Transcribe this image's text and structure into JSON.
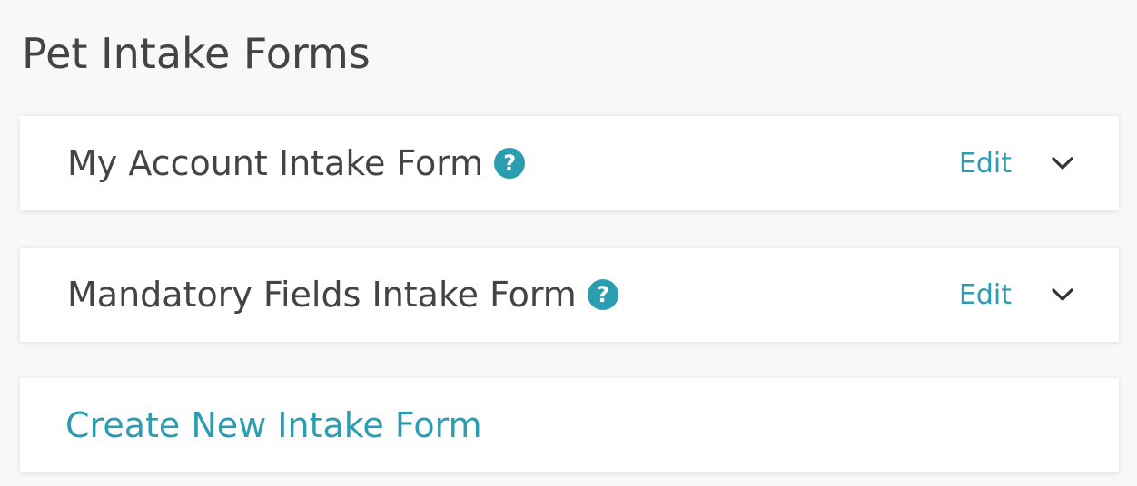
{
  "page": {
    "title": "Pet Intake Forms"
  },
  "forms": [
    {
      "name": "My Account Intake Form",
      "help": "?",
      "edit_label": "Edit"
    },
    {
      "name": "Mandatory Fields Intake Form",
      "help": "?",
      "edit_label": "Edit"
    }
  ],
  "create": {
    "label": "Create New Intake Form"
  },
  "colors": {
    "accent": "#2b9db1",
    "text": "#444444",
    "background": "#f8f8f8",
    "card": "#ffffff"
  }
}
